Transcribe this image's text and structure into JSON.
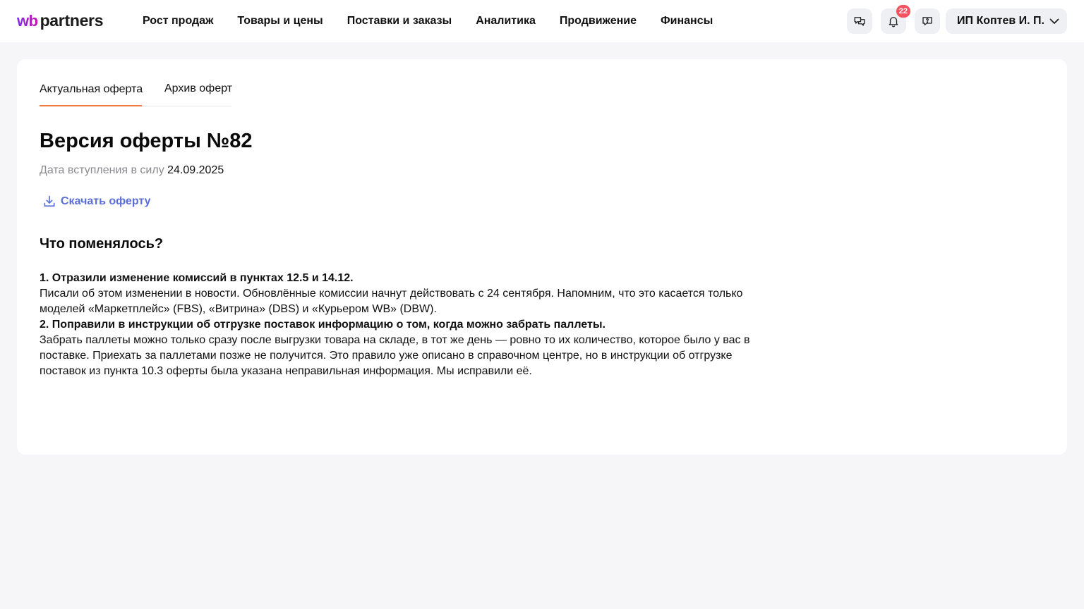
{
  "header": {
    "logo_wb": "wb",
    "logo_partners": "partners",
    "nav": [
      "Рост продаж",
      "Товары и цены",
      "Поставки и заказы",
      "Аналитика",
      "Продвижение",
      "Финансы"
    ],
    "notifications_count": "22",
    "account_name": "ИП Коптев И. П."
  },
  "tabs": {
    "current": "Актуальная оферта",
    "archive": "Архив оферт"
  },
  "offer": {
    "title": "Версия оферты №82",
    "date_label": "Дата вступления в силу",
    "date_value": "24.09.2025",
    "download_label": "Скачать оферту"
  },
  "changes": {
    "title": "Что поменялось?",
    "items": [
      {
        "title": "1. Отразили изменение комиссий в пунктах 12.5 и 14.12.",
        "text": "Писали об этом изменении в новости. Обновлённые комиссии начнут действовать с 24 сентября. Напомним, что это касается только моделей «Маркетплейс» (FBS), «Витрина» (DBS) и «Курьером WB» (DBW)."
      },
      {
        "title": "2. Поправили в инструкции об отгрузке поставок информацию о том, когда можно забрать паллеты.",
        "text": "Забрать паллеты можно только сразу после выгрузки товара на складе, в тот же день — ровно то их количество, которое было у вас в поставке. Приехать за паллетами позже не получится. Это правило уже описано в справочном центре, но в инструкции об отгрузке поставок из пункта 10.3 оферты была указана неправильная информация. Мы исправили её."
      }
    ]
  },
  "colors": {
    "accent_tab": "#f0793c",
    "link": "#5b6ed8",
    "badge": "#f5515f",
    "page_bg": "#f6f6f8"
  },
  "icons": [
    "chat-icon",
    "bell-icon",
    "feedback-icon",
    "chevron-down-icon",
    "download-icon"
  ]
}
